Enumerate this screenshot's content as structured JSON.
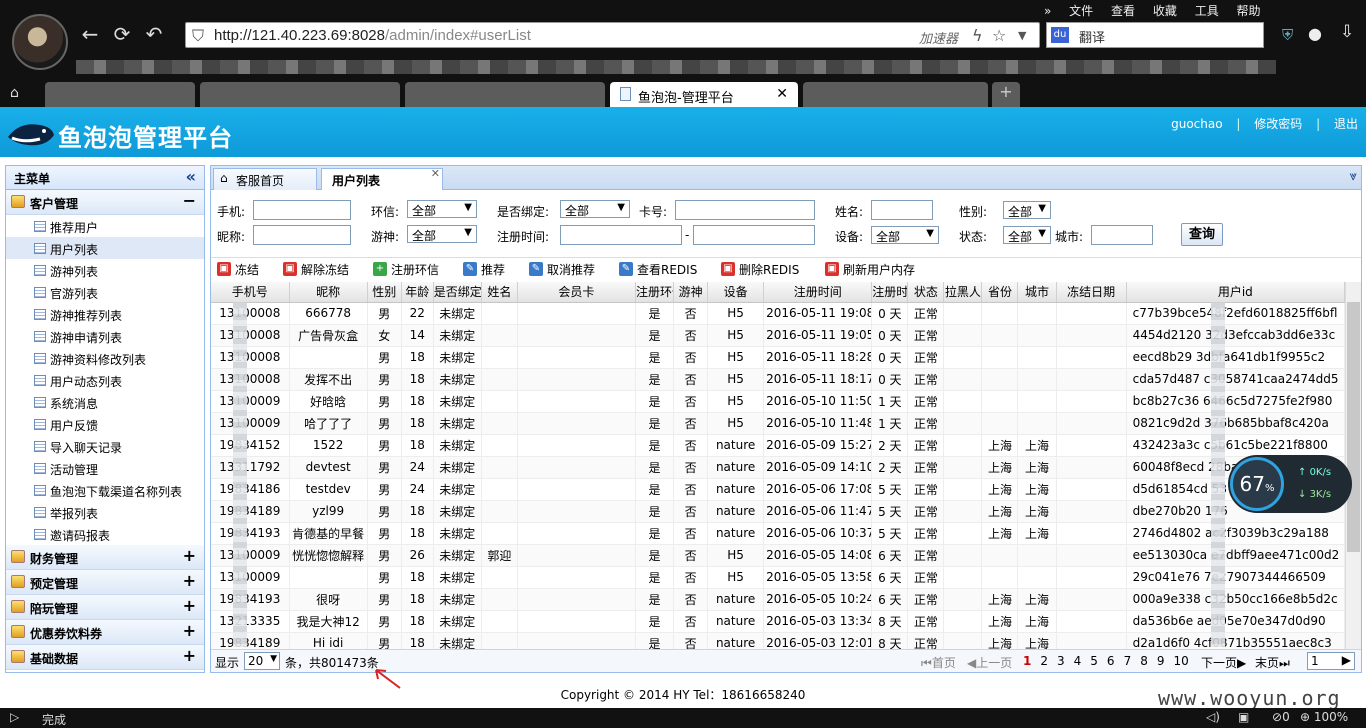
{
  "browser": {
    "url_host": "http://121.40.223.69:8028",
    "url_path": "/admin/index#userList",
    "accelerator_label": "加速器",
    "menu": [
      "文件",
      "查看",
      "收藏",
      "工具",
      "帮助"
    ],
    "translate_label": "翻译",
    "active_tab_title": "鱼泡泡-管理平台",
    "status_text": "完成",
    "zoom_text": "100%",
    "status_count": "0"
  },
  "header": {
    "title": "鱼泡泡管理平台",
    "username": "guochao",
    "change_password": "修改密码",
    "logout": "退出"
  },
  "sidebar": {
    "title": "主菜单",
    "groups": [
      {
        "label": "客户管理",
        "expanded": true,
        "items": [
          "推荐用户",
          "用户列表",
          "游神列表",
          "官游列表",
          "游神推荐列表",
          "游神申请列表",
          "游神资料修改列表",
          "用户动态列表",
          "系统消息",
          "用户反馈",
          "导入聊天记录",
          "活动管理",
          "鱼泡泡下载渠道名称列表",
          "举报列表",
          "邀请码报表"
        ]
      },
      {
        "label": "财务管理",
        "expanded": false
      },
      {
        "label": "预定管理",
        "expanded": false
      },
      {
        "label": "陪玩管理",
        "expanded": false
      },
      {
        "label": "优惠券饮料券",
        "expanded": false
      },
      {
        "label": "基础数据",
        "expanded": false
      }
    ]
  },
  "tabs": [
    {
      "label": "客服首页"
    },
    {
      "label": "用户列表",
      "active": true
    }
  ],
  "filters": {
    "phone": "手机:",
    "huanxin": "环信:",
    "huanxin_value": "全部",
    "bound": "是否绑定:",
    "bound_value": "全部",
    "card": "卡号:",
    "name": "姓名:",
    "gender": "性别:",
    "gender_value": "全部",
    "nickname": "昵称:",
    "youshen": "游神:",
    "youshen_value": "全部",
    "regtime": "注册时间:",
    "range_sep": "-",
    "device": "设备:",
    "device_value": "全部",
    "state": "状态:",
    "state_value": "全部",
    "city": "城市:",
    "query_button": "查询"
  },
  "toolbar": [
    "冻结",
    "解除冻结",
    "注册环信",
    "推荐",
    "取消推荐",
    "查看REDIS",
    "删除REDIS",
    "刷新用户内存"
  ],
  "table": {
    "columns": [
      "手机号",
      "昵称",
      "性别",
      "年龄",
      "是否绑定",
      "姓名",
      "会员卡",
      "注册环信",
      "游神",
      "设备",
      "注册时间",
      "注册时长",
      "状态",
      "拉黑人",
      "省份",
      "城市",
      "冻结日期",
      "用户id"
    ],
    "rows": [
      [
        "13100008",
        "666778",
        "男",
        "22",
        "未绑定",
        "",
        "",
        "是",
        "否",
        "H5",
        "2016-05-11 19:08",
        "0 天",
        "正常",
        "",
        "",
        "",
        "",
        "c77b39bce548f2efd6018825ff6bfl"
      ],
      [
        "13100008",
        "广告骨灰盒",
        "女",
        "14",
        "未绑定",
        "",
        "",
        "是",
        "否",
        "H5",
        "2016-05-11 19:05",
        "0 天",
        "正常",
        "",
        "",
        "",
        "",
        "4454d2120 32d3efccab3dd6e33c"
      ],
      [
        "13100008",
        "",
        "男",
        "18",
        "未绑定",
        "",
        "",
        "是",
        "否",
        "H5",
        "2016-05-11 18:28",
        "0 天",
        "正常",
        "",
        "",
        "",
        "",
        "eecd8b29 3dbfa641db1f9955c2"
      ],
      [
        "13100008",
        "发挥不出",
        "男",
        "18",
        "未绑定",
        "",
        "",
        "是",
        "否",
        "H5",
        "2016-05-11 18:17",
        "0 天",
        "正常",
        "",
        "",
        "",
        "",
        "cda57d487 c3058741caa2474dd5"
      ],
      [
        "13100009",
        "好晗晗",
        "男",
        "18",
        "未绑定",
        "",
        "",
        "是",
        "否",
        "H5",
        "2016-05-10 11:50",
        "1 天",
        "正常",
        "",
        "",
        "",
        "",
        "bc8b27c36 6466c5d7275fe2f980"
      ],
      [
        "13100009",
        "哈了了了",
        "男",
        "18",
        "未绑定",
        "",
        "",
        "是",
        "否",
        "H5",
        "2016-05-10 11:48",
        "1 天",
        "正常",
        "",
        "",
        "",
        "",
        "0821c9d2d 376b685bbaf8c420a"
      ],
      [
        "19834152",
        "1522",
        "男",
        "18",
        "未绑定",
        "",
        "",
        "是",
        "否",
        "nature",
        "2016-05-09 15:27",
        "2 天",
        "正常",
        "",
        "上海",
        "上海",
        "",
        "432423a3c c5b61c5be221f8800"
      ],
      [
        "13311792",
        "devtest",
        "男",
        "24",
        "未绑定",
        "",
        "",
        "是",
        "否",
        "nature",
        "2016-05-09 14:10",
        "2 天",
        "正常",
        "",
        "上海",
        "上海",
        "",
        "60048f8ecd 28ba4c1"
      ],
      [
        "19834186",
        "testdev",
        "男",
        "24",
        "未绑定",
        "",
        "",
        "是",
        "否",
        "nature",
        "2016-05-06 17:08",
        "5 天",
        "正常",
        "",
        "上海",
        "上海",
        "",
        "d5d61854cd 53"
      ],
      [
        "19834189",
        "yzl99",
        "男",
        "18",
        "未绑定",
        "",
        "",
        "是",
        "否",
        "nature",
        "2016-05-06 11:47",
        "5 天",
        "正常",
        "",
        "上海",
        "上海",
        "",
        "dbe270b20 176"
      ],
      [
        "19834193",
        "肯德基的早餐",
        "男",
        "18",
        "未绑定",
        "",
        "",
        "是",
        "否",
        "nature",
        "2016-05-06 10:37",
        "5 天",
        "正常",
        "",
        "上海",
        "上海",
        "",
        "2746d4802 ac2f3039b3c29a188"
      ],
      [
        "13100009",
        "恍恍惚惚解释",
        "男",
        "26",
        "未绑定",
        "郭迎",
        "",
        "是",
        "否",
        "H5",
        "2016-05-05 14:08",
        "6 天",
        "正常",
        "",
        "",
        "",
        "",
        "ee513030ca e7dbff9aee471c00d2"
      ],
      [
        "13100009",
        "",
        "男",
        "18",
        "未绑定",
        "",
        "",
        "是",
        "否",
        "H5",
        "2016-05-05 13:58",
        "6 天",
        "正常",
        "",
        "",
        "",
        "",
        "29c041e76 7e27907344466509"
      ],
      [
        "19834193",
        "很呀",
        "男",
        "18",
        "未绑定",
        "",
        "",
        "是",
        "否",
        "nature",
        "2016-05-05 10:24",
        "6 天",
        "正常",
        "",
        "上海",
        "上海",
        "",
        "000a9e338 c32b50cc166e8b5d2c"
      ],
      [
        "13213335",
        "我是大神12",
        "男",
        "18",
        "未绑定",
        "",
        "",
        "是",
        "否",
        "nature",
        "2016-05-03 13:34",
        "8 天",
        "正常",
        "",
        "上海",
        "上海",
        "",
        "da536b6e aed05e70e347d0d90"
      ],
      [
        "19834189",
        "Hi idi",
        "男",
        "18",
        "未绑定",
        "",
        "",
        "是",
        "否",
        "nature",
        "2016-05-03 12:01",
        "8 天",
        "正常",
        "",
        "上海",
        "上海",
        "",
        "d2a1d6f0 4cf0871b35551aec8c3"
      ]
    ]
  },
  "pager": {
    "show_prefix": "显示",
    "page_size": "20",
    "summary": "条，共801473条",
    "first": "首页",
    "prev": "上一页",
    "pages": [
      "1",
      "2",
      "3",
      "4",
      "5",
      "6",
      "7",
      "8",
      "9",
      "10"
    ],
    "current_page": "1",
    "next": "下一页",
    "last": "末页",
    "jump_value": "1"
  },
  "footer": {
    "copyright": "Copyright © 2014 HY Tel：18616658240"
  },
  "watermark": "www.wooyun.org",
  "gauge": {
    "percent": "67",
    "percent_unit": "%",
    "up": "0K/s",
    "down": "3K/s"
  },
  "colors": {
    "header_bg": "#14a8e6",
    "accent_blue": "#99bbe8",
    "current_page": "#cc0000"
  },
  "icons": {
    "back": "back-arrow-icon",
    "refresh": "refresh-icon",
    "undo": "undo-icon",
    "star": "star-icon",
    "download": "download-icon",
    "shield": "shield-icon"
  }
}
